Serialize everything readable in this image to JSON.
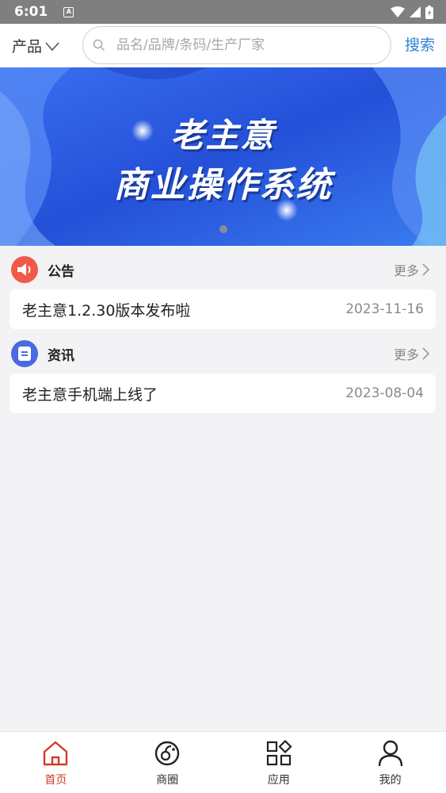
{
  "status_bar": {
    "time": "6:01",
    "notification_icon": "A"
  },
  "top_bar": {
    "category_label": "产品",
    "search_placeholder": "品名/品牌/条码/生产厂家",
    "search_button": "搜索"
  },
  "banner": {
    "line1": "老主意",
    "line2": "商业操作系统"
  },
  "announcement": {
    "title": "公告",
    "more_label": "更多",
    "items": [
      {
        "title": "老主意1.2.30版本发布啦",
        "date": "2023-11-16"
      }
    ]
  },
  "news": {
    "title": "资讯",
    "more_label": "更多",
    "items": [
      {
        "title": "老主意手机端上线了",
        "date": "2023-08-04"
      }
    ]
  },
  "tab_bar": {
    "tabs": [
      {
        "label": "首页",
        "icon": "home-icon",
        "active": true
      },
      {
        "label": "商圈",
        "icon": "circle-icon",
        "active": false
      },
      {
        "label": "应用",
        "icon": "apps-icon",
        "active": false
      },
      {
        "label": "我的",
        "icon": "user-icon",
        "active": false
      }
    ]
  },
  "colors": {
    "accent": "#d63a2a",
    "link": "#2f80d6",
    "banner": "#2f5fe0"
  }
}
